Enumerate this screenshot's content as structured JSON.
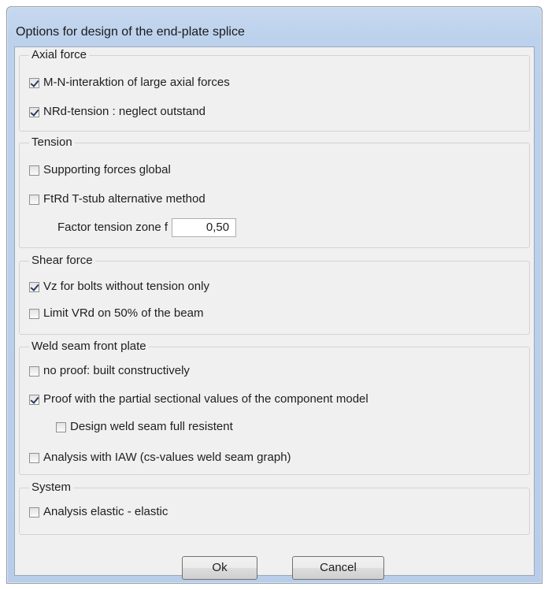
{
  "window": {
    "title": "Options for design of the end-plate splice"
  },
  "groups": {
    "axial": {
      "title": "Axial force",
      "items": [
        {
          "label": "M-N-interaktion of large axial forces",
          "checked": true
        },
        {
          "label": "NRd-tension : neglect outstand",
          "checked": true
        }
      ]
    },
    "tension": {
      "title": "Tension",
      "items": [
        {
          "label": "Supporting forces global",
          "checked": false
        },
        {
          "label": "FtRd T-stub alternative method",
          "checked": false
        }
      ],
      "factor_label": "Factor tension zone f",
      "factor_value": "0,50"
    },
    "shear": {
      "title": "Shear force",
      "items": [
        {
          "label": "Vz for bolts without tension only",
          "checked": true
        },
        {
          "label": "Limit VRd on 50% of the beam",
          "checked": false
        }
      ]
    },
    "weld": {
      "title": "Weld seam front plate",
      "items": [
        {
          "label": "no proof: built constructively",
          "checked": false
        },
        {
          "label": "Proof with the partial sectional values of the component model",
          "checked": true
        },
        {
          "label": "Design weld seam full resistent",
          "checked": false
        },
        {
          "label": "Analysis with IAW (cs-values weld seam graph)",
          "checked": false
        }
      ]
    },
    "system": {
      "title": "System",
      "items": [
        {
          "label": "Analysis elastic - elastic",
          "checked": false
        }
      ]
    }
  },
  "buttons": {
    "ok": "Ok",
    "cancel": "Cancel"
  }
}
